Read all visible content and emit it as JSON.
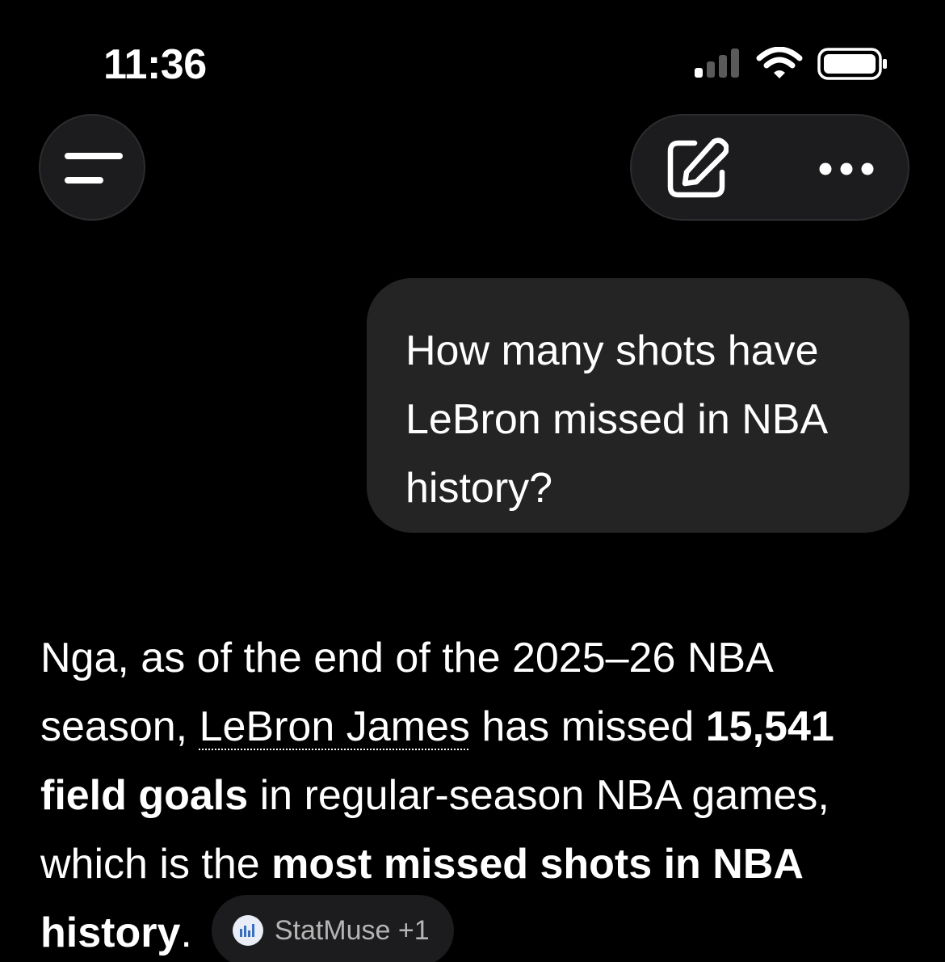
{
  "status_bar": {
    "time": "11:36"
  },
  "conversation": {
    "user_message": "How many shots have LeBron missed in NBA history?",
    "answer": {
      "part1": "Nga, as of the end of the 2025–26 NBA season, ",
      "entity_link": "LeBron James",
      "part2": " has missed ",
      "bold1": "15,541 field goals",
      "part3": " in regular-season NBA games, which is the ",
      "bold2": "most missed shots in NBA history",
      "part4": "."
    },
    "source_chip": {
      "label": "StatMuse +1",
      "icon": "statmuse-logo-icon"
    }
  },
  "colors": {
    "background": "#000000",
    "bubble": "#242424",
    "control_bg": "#1c1c1e",
    "chip_text": "#b5b5b5"
  }
}
